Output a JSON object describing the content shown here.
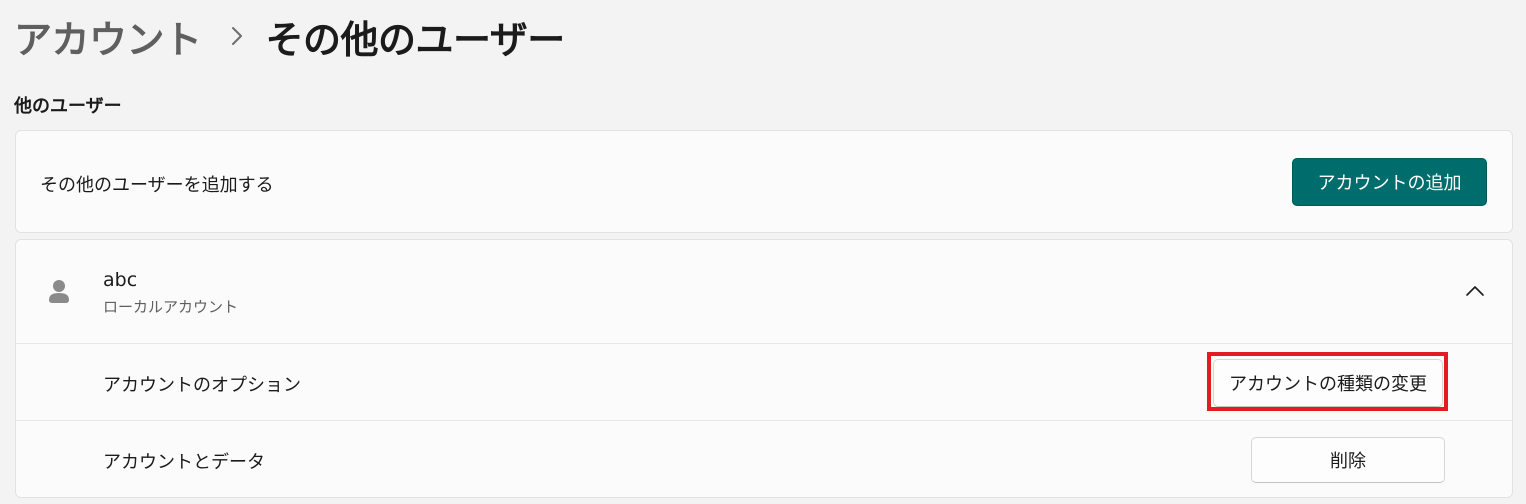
{
  "breadcrumb": {
    "parent": "アカウント",
    "separator": "›",
    "current": "その他のユーザー"
  },
  "section": {
    "title": "他のユーザー"
  },
  "add_card": {
    "label": "その他のユーザーを追加する",
    "button_label": "アカウントの追加"
  },
  "user_card": {
    "name": "abc",
    "type": "ローカルアカウント",
    "avatar_icon": "person-icon",
    "expand_icon": "chevron-up-icon",
    "options": [
      {
        "label": "アカウントのオプション",
        "button_label": "アカウントの種類の変更"
      },
      {
        "label": "アカウントとデータ",
        "button_label": "削除"
      }
    ]
  },
  "colors": {
    "accent": "#006d6d",
    "highlight": "#e31b23",
    "background": "#f3f3f3",
    "card": "#fbfbfb"
  }
}
